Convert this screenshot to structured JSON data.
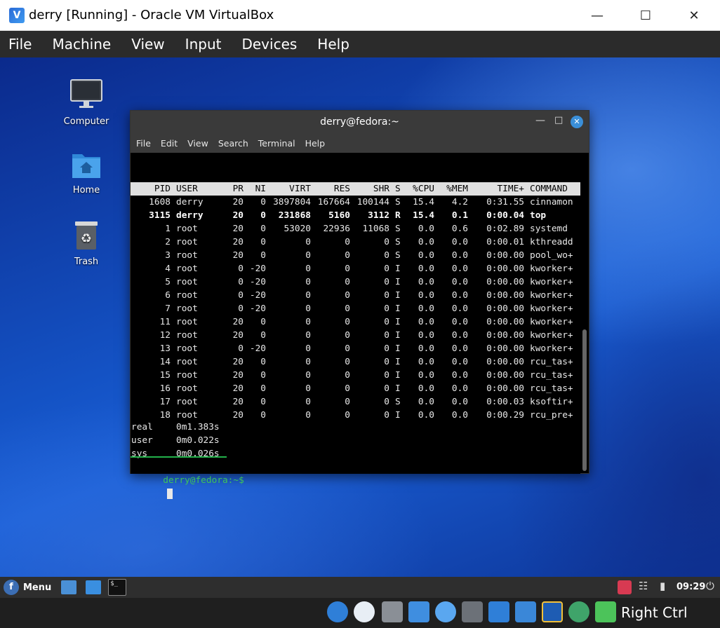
{
  "window": {
    "title": "derry [Running] - Oracle VM VirtualBox",
    "menu": [
      "File",
      "Machine",
      "View",
      "Input",
      "Devices",
      "Help"
    ]
  },
  "desktop": {
    "icons": [
      {
        "label": "Computer",
        "icon": "monitor-icon"
      },
      {
        "label": "Home",
        "icon": "home-folder-icon"
      },
      {
        "label": "Trash",
        "icon": "trash-icon"
      }
    ]
  },
  "terminal": {
    "title": "derry@fedora:~",
    "menu": [
      "File",
      "Edit",
      "View",
      "Search",
      "Terminal",
      "Help"
    ],
    "columns": [
      "PID",
      "USER",
      "PR",
      "NI",
      "VIRT",
      "RES",
      "SHR",
      "S",
      "%CPU",
      "%MEM",
      "TIME+",
      "COMMAND"
    ],
    "rows": [
      {
        "pid": "1608",
        "user": "derry",
        "pr": "20",
        "ni": "0",
        "virt": "3897804",
        "res": "167664",
        "shr": "100144",
        "s": "S",
        "cpu": "15.4",
        "mem": "4.2",
        "time": "0:31.55",
        "cmd": "cinnamon",
        "bold": false
      },
      {
        "pid": "3115",
        "user": "derry",
        "pr": "20",
        "ni": "0",
        "virt": "231868",
        "res": "5160",
        "shr": "3112",
        "s": "R",
        "cpu": "15.4",
        "mem": "0.1",
        "time": "0:00.04",
        "cmd": "top",
        "bold": true
      },
      {
        "pid": "1",
        "user": "root",
        "pr": "20",
        "ni": "0",
        "virt": "53020",
        "res": "22936",
        "shr": "11068",
        "s": "S",
        "cpu": "0.0",
        "mem": "0.6",
        "time": "0:02.89",
        "cmd": "systemd",
        "bold": false
      },
      {
        "pid": "2",
        "user": "root",
        "pr": "20",
        "ni": "0",
        "virt": "0",
        "res": "0",
        "shr": "0",
        "s": "S",
        "cpu": "0.0",
        "mem": "0.0",
        "time": "0:00.01",
        "cmd": "kthreadd",
        "bold": false
      },
      {
        "pid": "3",
        "user": "root",
        "pr": "20",
        "ni": "0",
        "virt": "0",
        "res": "0",
        "shr": "0",
        "s": "S",
        "cpu": "0.0",
        "mem": "0.0",
        "time": "0:00.00",
        "cmd": "pool_wo+",
        "bold": false
      },
      {
        "pid": "4",
        "user": "root",
        "pr": "0",
        "ni": "-20",
        "virt": "0",
        "res": "0",
        "shr": "0",
        "s": "I",
        "cpu": "0.0",
        "mem": "0.0",
        "time": "0:00.00",
        "cmd": "kworker+",
        "bold": false
      },
      {
        "pid": "5",
        "user": "root",
        "pr": "0",
        "ni": "-20",
        "virt": "0",
        "res": "0",
        "shr": "0",
        "s": "I",
        "cpu": "0.0",
        "mem": "0.0",
        "time": "0:00.00",
        "cmd": "kworker+",
        "bold": false
      },
      {
        "pid": "6",
        "user": "root",
        "pr": "0",
        "ni": "-20",
        "virt": "0",
        "res": "0",
        "shr": "0",
        "s": "I",
        "cpu": "0.0",
        "mem": "0.0",
        "time": "0:00.00",
        "cmd": "kworker+",
        "bold": false
      },
      {
        "pid": "7",
        "user": "root",
        "pr": "0",
        "ni": "-20",
        "virt": "0",
        "res": "0",
        "shr": "0",
        "s": "I",
        "cpu": "0.0",
        "mem": "0.0",
        "time": "0:00.00",
        "cmd": "kworker+",
        "bold": false
      },
      {
        "pid": "11",
        "user": "root",
        "pr": "20",
        "ni": "0",
        "virt": "0",
        "res": "0",
        "shr": "0",
        "s": "I",
        "cpu": "0.0",
        "mem": "0.0",
        "time": "0:00.00",
        "cmd": "kworker+",
        "bold": false
      },
      {
        "pid": "12",
        "user": "root",
        "pr": "20",
        "ni": "0",
        "virt": "0",
        "res": "0",
        "shr": "0",
        "s": "I",
        "cpu": "0.0",
        "mem": "0.0",
        "time": "0:00.00",
        "cmd": "kworker+",
        "bold": false
      },
      {
        "pid": "13",
        "user": "root",
        "pr": "0",
        "ni": "-20",
        "virt": "0",
        "res": "0",
        "shr": "0",
        "s": "I",
        "cpu": "0.0",
        "mem": "0.0",
        "time": "0:00.00",
        "cmd": "kworker+",
        "bold": false
      },
      {
        "pid": "14",
        "user": "root",
        "pr": "20",
        "ni": "0",
        "virt": "0",
        "res": "0",
        "shr": "0",
        "s": "I",
        "cpu": "0.0",
        "mem": "0.0",
        "time": "0:00.00",
        "cmd": "rcu_tas+",
        "bold": false
      },
      {
        "pid": "15",
        "user": "root",
        "pr": "20",
        "ni": "0",
        "virt": "0",
        "res": "0",
        "shr": "0",
        "s": "I",
        "cpu": "0.0",
        "mem": "0.0",
        "time": "0:00.00",
        "cmd": "rcu_tas+",
        "bold": false
      },
      {
        "pid": "16",
        "user": "root",
        "pr": "20",
        "ni": "0",
        "virt": "0",
        "res": "0",
        "shr": "0",
        "s": "I",
        "cpu": "0.0",
        "mem": "0.0",
        "time": "0:00.00",
        "cmd": "rcu_tas+",
        "bold": false
      },
      {
        "pid": "17",
        "user": "root",
        "pr": "20",
        "ni": "0",
        "virt": "0",
        "res": "0",
        "shr": "0",
        "s": "S",
        "cpu": "0.0",
        "mem": "0.0",
        "time": "0:00.03",
        "cmd": "ksoftir+",
        "bold": false
      },
      {
        "pid": "18",
        "user": "root",
        "pr": "20",
        "ni": "0",
        "virt": "0",
        "res": "0",
        "shr": "0",
        "s": "I",
        "cpu": "0.0",
        "mem": "0.0",
        "time": "0:00.29",
        "cmd": "rcu_pre+",
        "bold": false
      }
    ],
    "timing": [
      {
        "label": "real",
        "value": "0m1.383s"
      },
      {
        "label": "user",
        "value": "0m0.022s"
      },
      {
        "label": "sys",
        "value": "0m0.026s"
      }
    ],
    "prompt": "derry@fedora:~$"
  },
  "panel": {
    "menu_label": "Menu",
    "clock": "09:29"
  },
  "status": {
    "host_key": "Right Ctrl"
  }
}
